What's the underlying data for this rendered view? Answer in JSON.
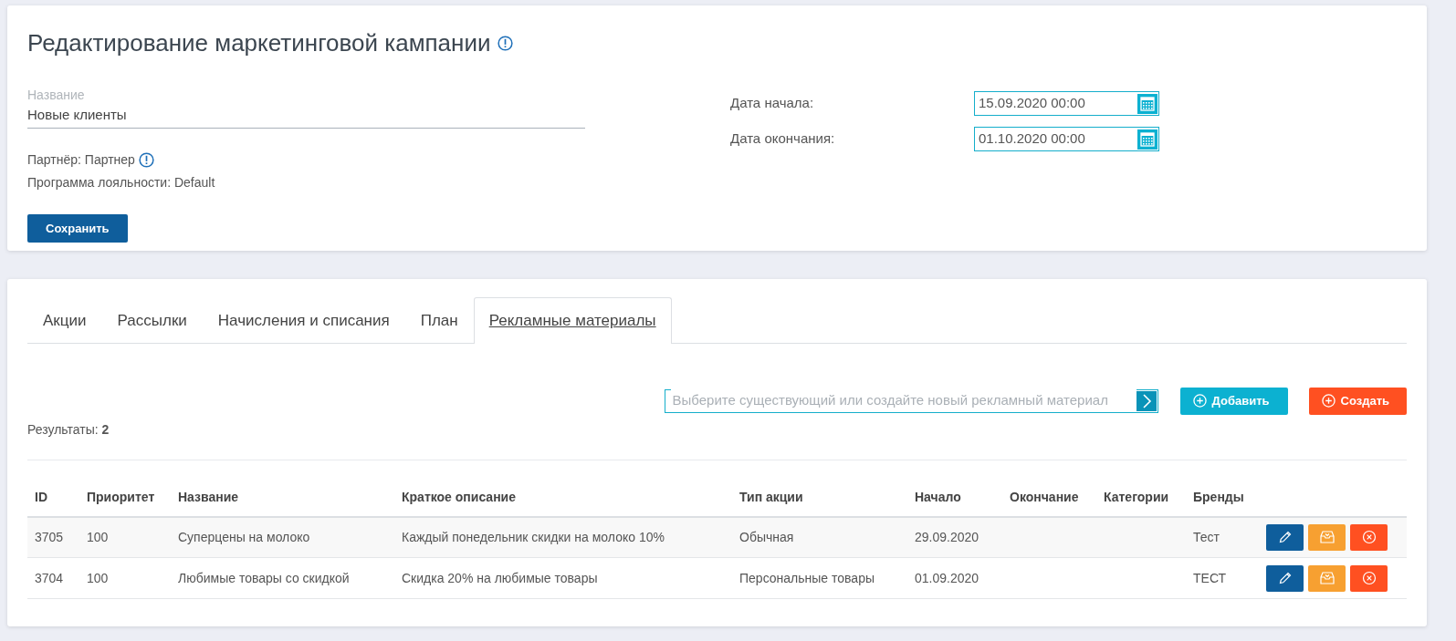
{
  "campaign": {
    "title": "Редактирование маркетинговой кампании",
    "name_field": {
      "label": "Название",
      "value": "Новые клиенты"
    },
    "partner": "Партнёр: Партнер",
    "loyalty_program": "Программа лояльности: Default",
    "save_button": "Сохранить",
    "dates": [
      {
        "label": "Дата начала:",
        "value": "15.09.2020 00:00"
      },
      {
        "label": "Дата окончания:",
        "value": "01.10.2020 00:00"
      }
    ]
  },
  "tabs": [
    {
      "label": "Акции",
      "selected": false
    },
    {
      "label": "Рассылки",
      "selected": false
    },
    {
      "label": "Начисления и списания",
      "selected": false
    },
    {
      "label": "План",
      "selected": false
    },
    {
      "label": "Рекламные материалы",
      "selected": true
    }
  ],
  "material_picker": {
    "placeholder": "Выберите существующий или создайте новый рекламный материал"
  },
  "buttons": [
    {
      "label": "Добавить",
      "kind": "add"
    },
    {
      "label": "Создать",
      "kind": "create"
    }
  ],
  "results": "Результаты: **2**",
  "table": {
    "columns": [
      "ID",
      "Приоритет",
      "Название",
      "Краткое описание",
      "Тип акции",
      "Начало",
      "Окончание",
      "Категории",
      "Бренды"
    ],
    "rows": [
      [
        "3705",
        "100",
        "Суперцены на молоко",
        "Каждый понедельник скидки на молоко 10%",
        "Обычная",
        "29.09.2020",
        "",
        "",
        "Тест"
      ],
      [
        "3704",
        "100",
        "Любимые товары со скидкой",
        "Скидка 20% на любимые товары",
        "Персональные товары",
        "01.09.2020",
        "",
        "",
        "ТЕСТ"
      ]
    ]
  }
}
